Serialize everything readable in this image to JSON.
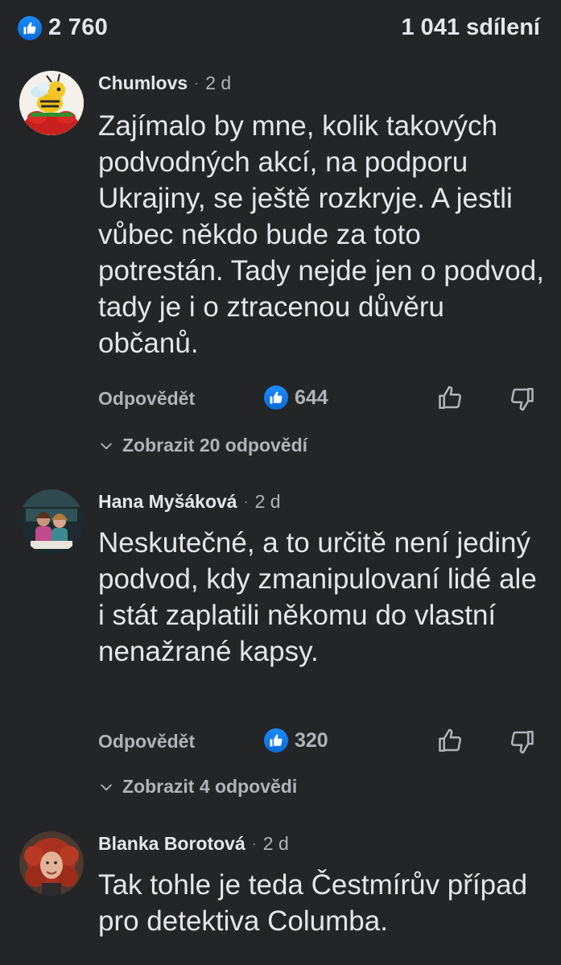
{
  "summary": {
    "reaction_icon": "like-icon",
    "reaction_count": "2 760",
    "shares_label": "1 041 sdílení"
  },
  "colors": {
    "background": "#242526",
    "like_blue": "#1877f2",
    "text_primary": "#e4e6eb",
    "text_secondary": "#b0b3b8"
  },
  "comments": [
    {
      "author": "Chumlovs",
      "time": "2 d",
      "text": "Zajímalo by mne, kolik takových podvodných akcí, na podporu Ukrajiny, se ještě rozkryje. A jestli vůbec někdo bude za toto potrestán. Tady nejde jen o podvod, tady je i o ztracenou důvěru občanů.",
      "reply_label": "Odpovědět",
      "like_count": "644",
      "view_replies_label": "Zobrazit 20 odpovědí"
    },
    {
      "author": "Hana Myšáková",
      "time": "2 d",
      "text": "Neskutečné, a to určitě není jediný podvod, kdy zmanipulovaní lidé ale i stát zaplatili někomu do vlastní nenažrané kapsy.",
      "reply_label": "Odpovědět",
      "like_count": "320",
      "view_replies_label": "Zobrazit 4 odpovědi"
    },
    {
      "author": "Blanka Borotová",
      "time": "2 d",
      "text": "Tak tohle je teda Čestmírův případ pro detektiva Columba."
    }
  ]
}
